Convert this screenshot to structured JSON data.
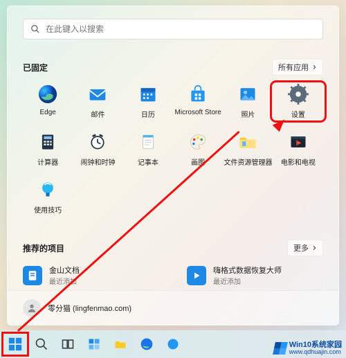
{
  "search": {
    "placeholder": "在此键入以搜索"
  },
  "pinned": {
    "title": "已固定",
    "all_apps_label": "所有应用",
    "apps": [
      {
        "name": "Edge"
      },
      {
        "name": "邮件"
      },
      {
        "name": "日历"
      },
      {
        "name": "Microsoft Store"
      },
      {
        "name": "照片"
      },
      {
        "name": "设置"
      },
      {
        "name": "计算器"
      },
      {
        "name": "闹钟和时钟"
      },
      {
        "name": "记事本"
      },
      {
        "name": "画图"
      },
      {
        "name": "文件资源管理器"
      },
      {
        "name": "电影和电视"
      },
      {
        "name": "使用技巧"
      }
    ]
  },
  "recommended": {
    "title": "推荐的项目",
    "more_label": "更多",
    "items": [
      {
        "title": "金山文档",
        "subtitle": "最近添加"
      },
      {
        "title": "嗨格式数据恢复大师",
        "subtitle": "最近添加"
      }
    ]
  },
  "user": {
    "display": "零分猫 (lingfenmao.com)"
  },
  "watermark": {
    "line1": "Win10系统家园",
    "line2": "www.qdhuajin.com"
  }
}
